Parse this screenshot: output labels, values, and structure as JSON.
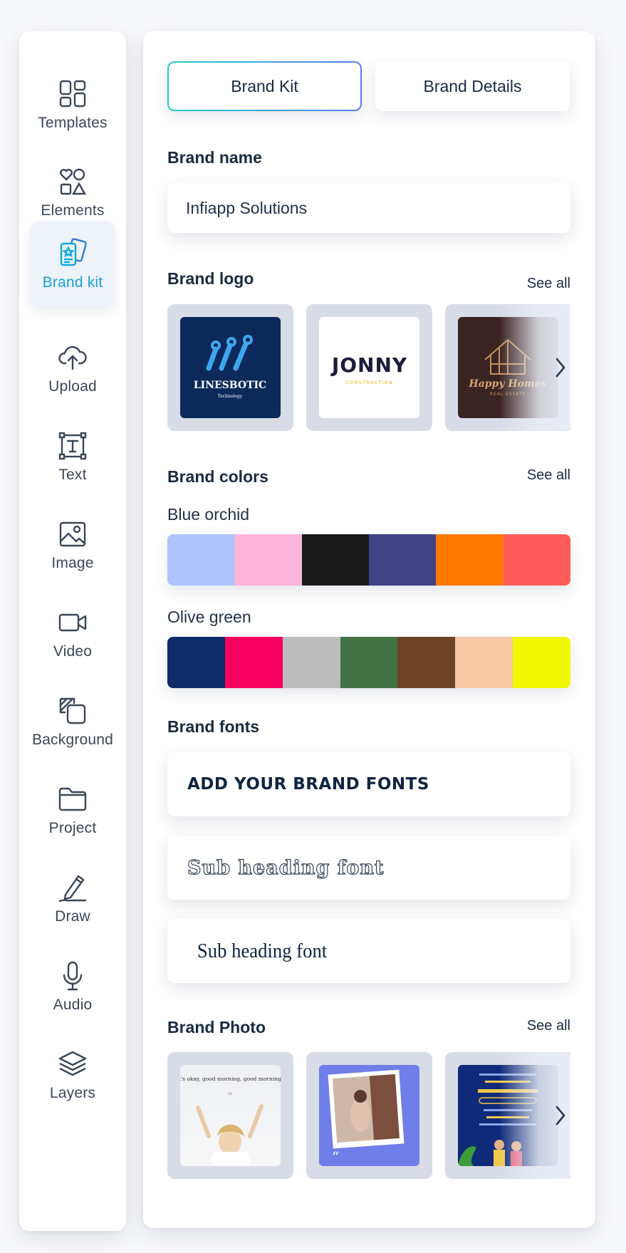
{
  "sidebar": {
    "items": [
      {
        "label": "Templates",
        "icon": "templates-icon"
      },
      {
        "label": "Elements",
        "icon": "elements-icon"
      },
      {
        "label": "Brand kit",
        "icon": "brand-kit-icon",
        "active": true
      },
      {
        "label": "Upload",
        "icon": "upload-cloud-icon"
      },
      {
        "label": "Text",
        "icon": "text-icon"
      },
      {
        "label": "Image",
        "icon": "image-icon"
      },
      {
        "label": "Video",
        "icon": "video-icon"
      },
      {
        "label": "Background",
        "icon": "background-icon"
      },
      {
        "label": "Project",
        "icon": "folder-icon"
      },
      {
        "label": "Draw",
        "icon": "pen-icon"
      },
      {
        "label": "Audio",
        "icon": "microphone-icon"
      },
      {
        "label": "Layers",
        "icon": "layers-icon"
      }
    ]
  },
  "tabs": {
    "brand_kit": "Brand Kit",
    "brand_details": "Brand Details"
  },
  "brand_name": {
    "title": "Brand name",
    "value": "Infiapp Solutions"
  },
  "brand_logo": {
    "title": "Brand logo",
    "see_all": "See all",
    "logos": [
      {
        "name": "LINESBOTIC",
        "tagline": "Technology"
      },
      {
        "name": "JONNY",
        "tagline": "CONSTRUCTION"
      },
      {
        "name": "Happy Homes",
        "tagline": "REAL ESTATE"
      }
    ]
  },
  "brand_colors": {
    "title": "Brand colors",
    "see_all": "See all",
    "palettes": [
      {
        "name": "Blue orchid",
        "colors": [
          "#afc4fc",
          "#fcb5d8",
          "#1a1a1a",
          "#404284",
          "#fd7902",
          "#fe5c5a"
        ]
      },
      {
        "name": "Olive green",
        "colors": [
          "#0f2a68",
          "#f6005d",
          "#bcbcbc",
          "#427243",
          "#6d4526",
          "#f6c8a4",
          "#f2f800"
        ]
      }
    ]
  },
  "brand_fonts": {
    "title": "Brand fonts",
    "fonts": [
      {
        "sample": "ADD YOUR BRAND FONTS"
      },
      {
        "sample": "Sub heading font"
      },
      {
        "sample": "Sub heading font"
      }
    ]
  },
  "brand_photo": {
    "title": "Brand Photo",
    "see_all": "See all",
    "photos": [
      {
        "caption": "It's okay, good morning, good morning!"
      },
      {
        "caption": ""
      },
      {
        "caption": ""
      }
    ]
  },
  "colors": {
    "accent": "#1aa0d8",
    "text": "#1b2a41",
    "tile_bg": "#d8dce6"
  }
}
